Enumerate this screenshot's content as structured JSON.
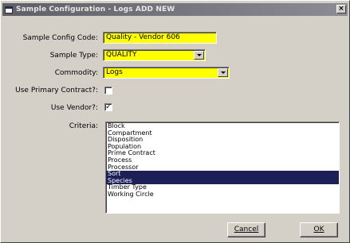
{
  "window": {
    "title": "Sample Configuration - Logs ADD NEW",
    "close_symbol": "×"
  },
  "form": {
    "config_code_label": "Sample Config Code:",
    "config_code_value": "Quality - Vendor 606",
    "sample_type_label": "Sample Type:",
    "sample_type_value": "QUALITY",
    "commodity_label": "Commodity:",
    "commodity_value": "Logs",
    "use_primary_contract_label": "Use Primary Contract?:",
    "use_primary_contract_checked": "",
    "use_vendor_label": "Use Vendor?:",
    "use_vendor_checked": "✓",
    "criteria_label": "Criteria:"
  },
  "criteria_items": [
    {
      "label": "Block",
      "selected": false
    },
    {
      "label": "Compartment",
      "selected": false
    },
    {
      "label": "Disposition",
      "selected": false
    },
    {
      "label": "Population",
      "selected": false
    },
    {
      "label": "Prime Contract",
      "selected": false
    },
    {
      "label": "Process",
      "selected": false
    },
    {
      "label": "Processor",
      "selected": false
    },
    {
      "label": "Sort",
      "selected": true
    },
    {
      "label": "Species",
      "selected": true
    },
    {
      "label": "Timber Type",
      "selected": false
    },
    {
      "label": "Working Circle",
      "selected": false
    }
  ],
  "buttons": {
    "cancel_label": "Cancel",
    "ok_label": "OK"
  },
  "colors": {
    "required_field": "#ffff00",
    "selection": "#1d1f57",
    "titlebar": "#6b6b72"
  }
}
